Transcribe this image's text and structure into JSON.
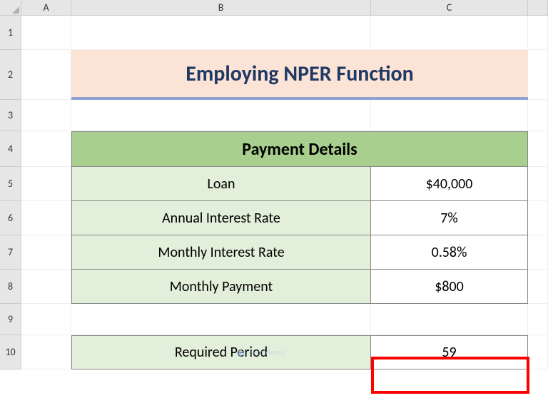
{
  "columns": [
    "",
    "A",
    "B",
    "C",
    ""
  ],
  "rows": [
    "1",
    "2",
    "3",
    "4",
    "5",
    "6",
    "7",
    "8",
    "9",
    "10"
  ],
  "title": "Employing NPER Function",
  "table_header": "Payment Details",
  "details": [
    {
      "label": "Loan",
      "value": "$40,000"
    },
    {
      "label": "Annual Interest Rate",
      "value": "7%"
    },
    {
      "label": "Monthly Interest Rate",
      "value": "0.58%"
    },
    {
      "label": "Monthly Payment",
      "value": "$800"
    }
  ],
  "result": {
    "label": "Required Period",
    "value": "59"
  },
  "watermark": "exceldemy",
  "chart_data": {
    "type": "table",
    "title": "Employing NPER Function",
    "sections": [
      {
        "header": "Payment Details",
        "rows": [
          [
            "Loan",
            "$40,000"
          ],
          [
            "Annual Interest Rate",
            "7%"
          ],
          [
            "Monthly Interest Rate",
            "0.58%"
          ],
          [
            "Monthly Payment",
            "$800"
          ]
        ]
      },
      {
        "rows": [
          [
            "Required Period",
            59
          ]
        ]
      }
    ]
  }
}
